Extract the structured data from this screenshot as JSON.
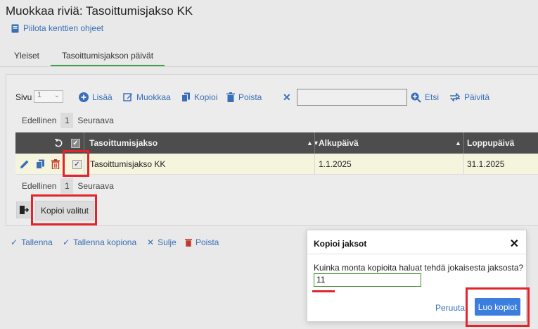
{
  "page": {
    "title": "Muokkaa riviä: Tasoittumisjakso KK",
    "help_link": "Piilota kenttien ohjeet"
  },
  "tabs": [
    {
      "label": "Yleiset"
    },
    {
      "label": "Tasoittumisjakson päivät",
      "active": true
    }
  ],
  "toolbar": {
    "page_label": "Sivu",
    "page_value": "1",
    "add": "Lisää",
    "edit": "Muokkaa",
    "copy": "Kopioi",
    "delete": "Poista",
    "clear": "✕",
    "search_value": "",
    "search": "Etsi",
    "refresh": "Päivitä"
  },
  "pager_top": {
    "prev": "Edellinen",
    "page": "1",
    "next": "Seuraava"
  },
  "pager_bottom": {
    "prev": "Edellinen",
    "page": "1",
    "next": "Seuraava"
  },
  "grid": {
    "columns": [
      "Tasoittumisjakso",
      "Alkupäivä",
      "Loppupäivä"
    ],
    "rows": [
      {
        "name": "Tasoittumisjakso KK",
        "start": "1.1.2025",
        "end": "31.1.2025",
        "checked": true
      }
    ]
  },
  "copy_selected": "Kopioi valitut",
  "footer": {
    "save": "Tallenna",
    "save_copy": "Tallenna kopiona",
    "close": "Sulje",
    "delete": "Poista"
  },
  "modal": {
    "title": "Kopioi jaksot",
    "close": "✕",
    "question": "Kuinka monta kopioita haluat tehdä jokaisesta jaksosta?",
    "value": "11",
    "cancel": "Peruuta",
    "ok": "Luo kopiot"
  },
  "colors": {
    "accent": "#3a6fb7",
    "primary_button": "#3c7ee0",
    "highlight": "#e3242b",
    "header_bg": "#4d4d4d",
    "selected_row": "#f4f5dc",
    "active_tab": "#3aa34a"
  }
}
